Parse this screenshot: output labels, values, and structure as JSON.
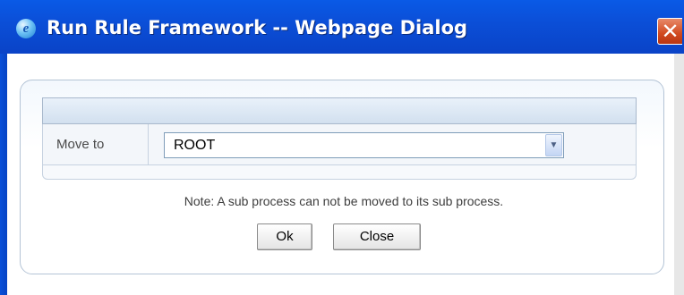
{
  "window": {
    "title": "Run Rule Framework -- Webpage Dialog",
    "app_icon": "internet-explorer-icon",
    "app_icon_glyph": "e",
    "close_icon": "close-icon",
    "close_glyph": "✕"
  },
  "form": {
    "move_to_label": "Move to",
    "move_to_value": "ROOT",
    "dropdown_icon": "chevron-down-icon",
    "dropdown_glyph": "▼"
  },
  "note": "Note: A sub process can not be moved to its sub process.",
  "buttons": {
    "ok_label": "Ok",
    "close_label": "Close"
  },
  "colors": {
    "titlebar": "#0b4fd8",
    "close_button": "#d1491f",
    "panel_border": "#b4c4d6"
  }
}
